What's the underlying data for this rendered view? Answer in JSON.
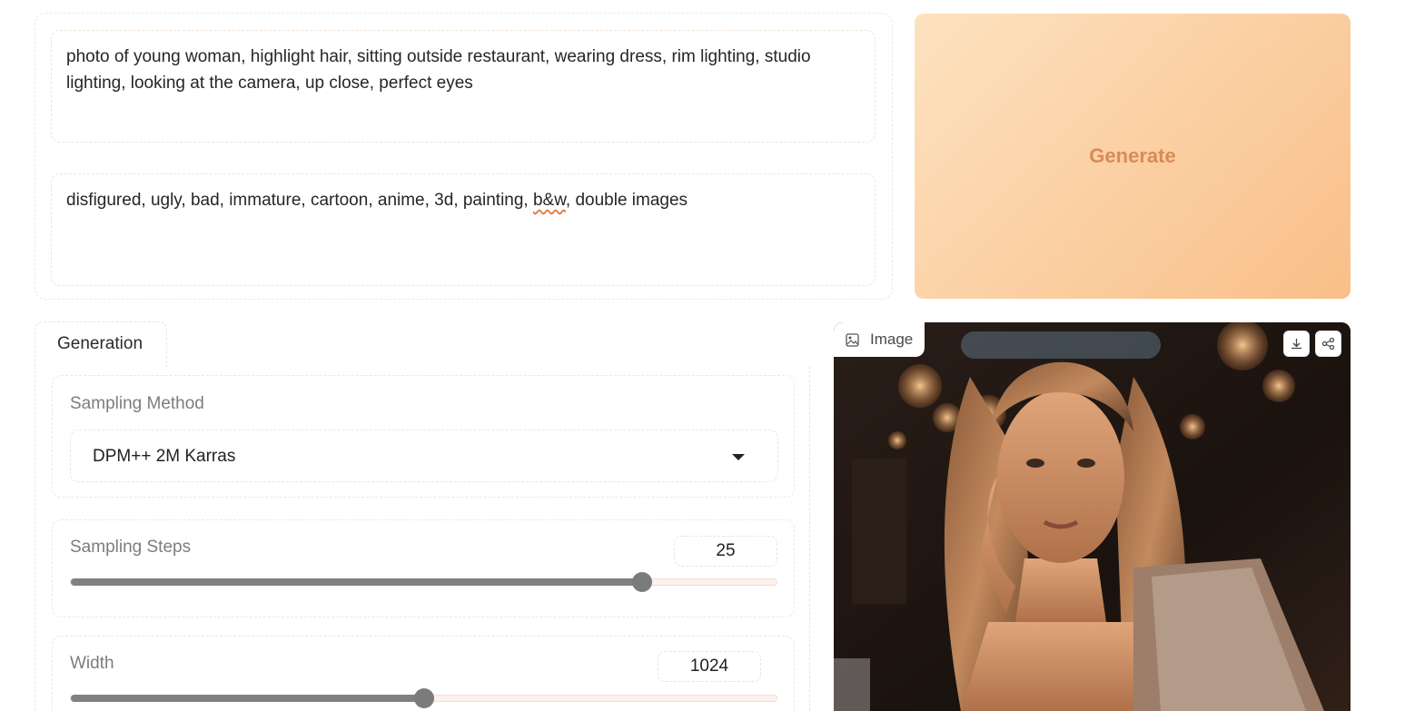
{
  "prompt": {
    "positive": "photo of young woman, highlight hair, sitting outside restaurant, wearing dress, rim lighting, studio lighting, looking at the camera, up close, perfect eyes",
    "negative_before": "disfigured, ugly, bad, immature, cartoon, anime, 3d, painting, ",
    "negative_flagged": "b&w",
    "negative_after": ", double images"
  },
  "generate_button": {
    "label": "Generate"
  },
  "tabs": [
    {
      "label": "Generation",
      "selected": true
    }
  ],
  "sampling_method": {
    "label": "Sampling Method",
    "value": "DPM++ 2M Karras"
  },
  "sampling_steps": {
    "label": "Sampling Steps",
    "value": "25",
    "fraction": 0.81
  },
  "width": {
    "label": "Width",
    "value": "1024",
    "fraction": 0.5
  },
  "output_image": {
    "label": "Image",
    "icons": [
      "image-icon",
      "download-icon",
      "share-icon"
    ]
  },
  "colors": {
    "accent": "#f9bf88",
    "generate_text": "#d98a56",
    "slider": "#7b7b7b"
  }
}
